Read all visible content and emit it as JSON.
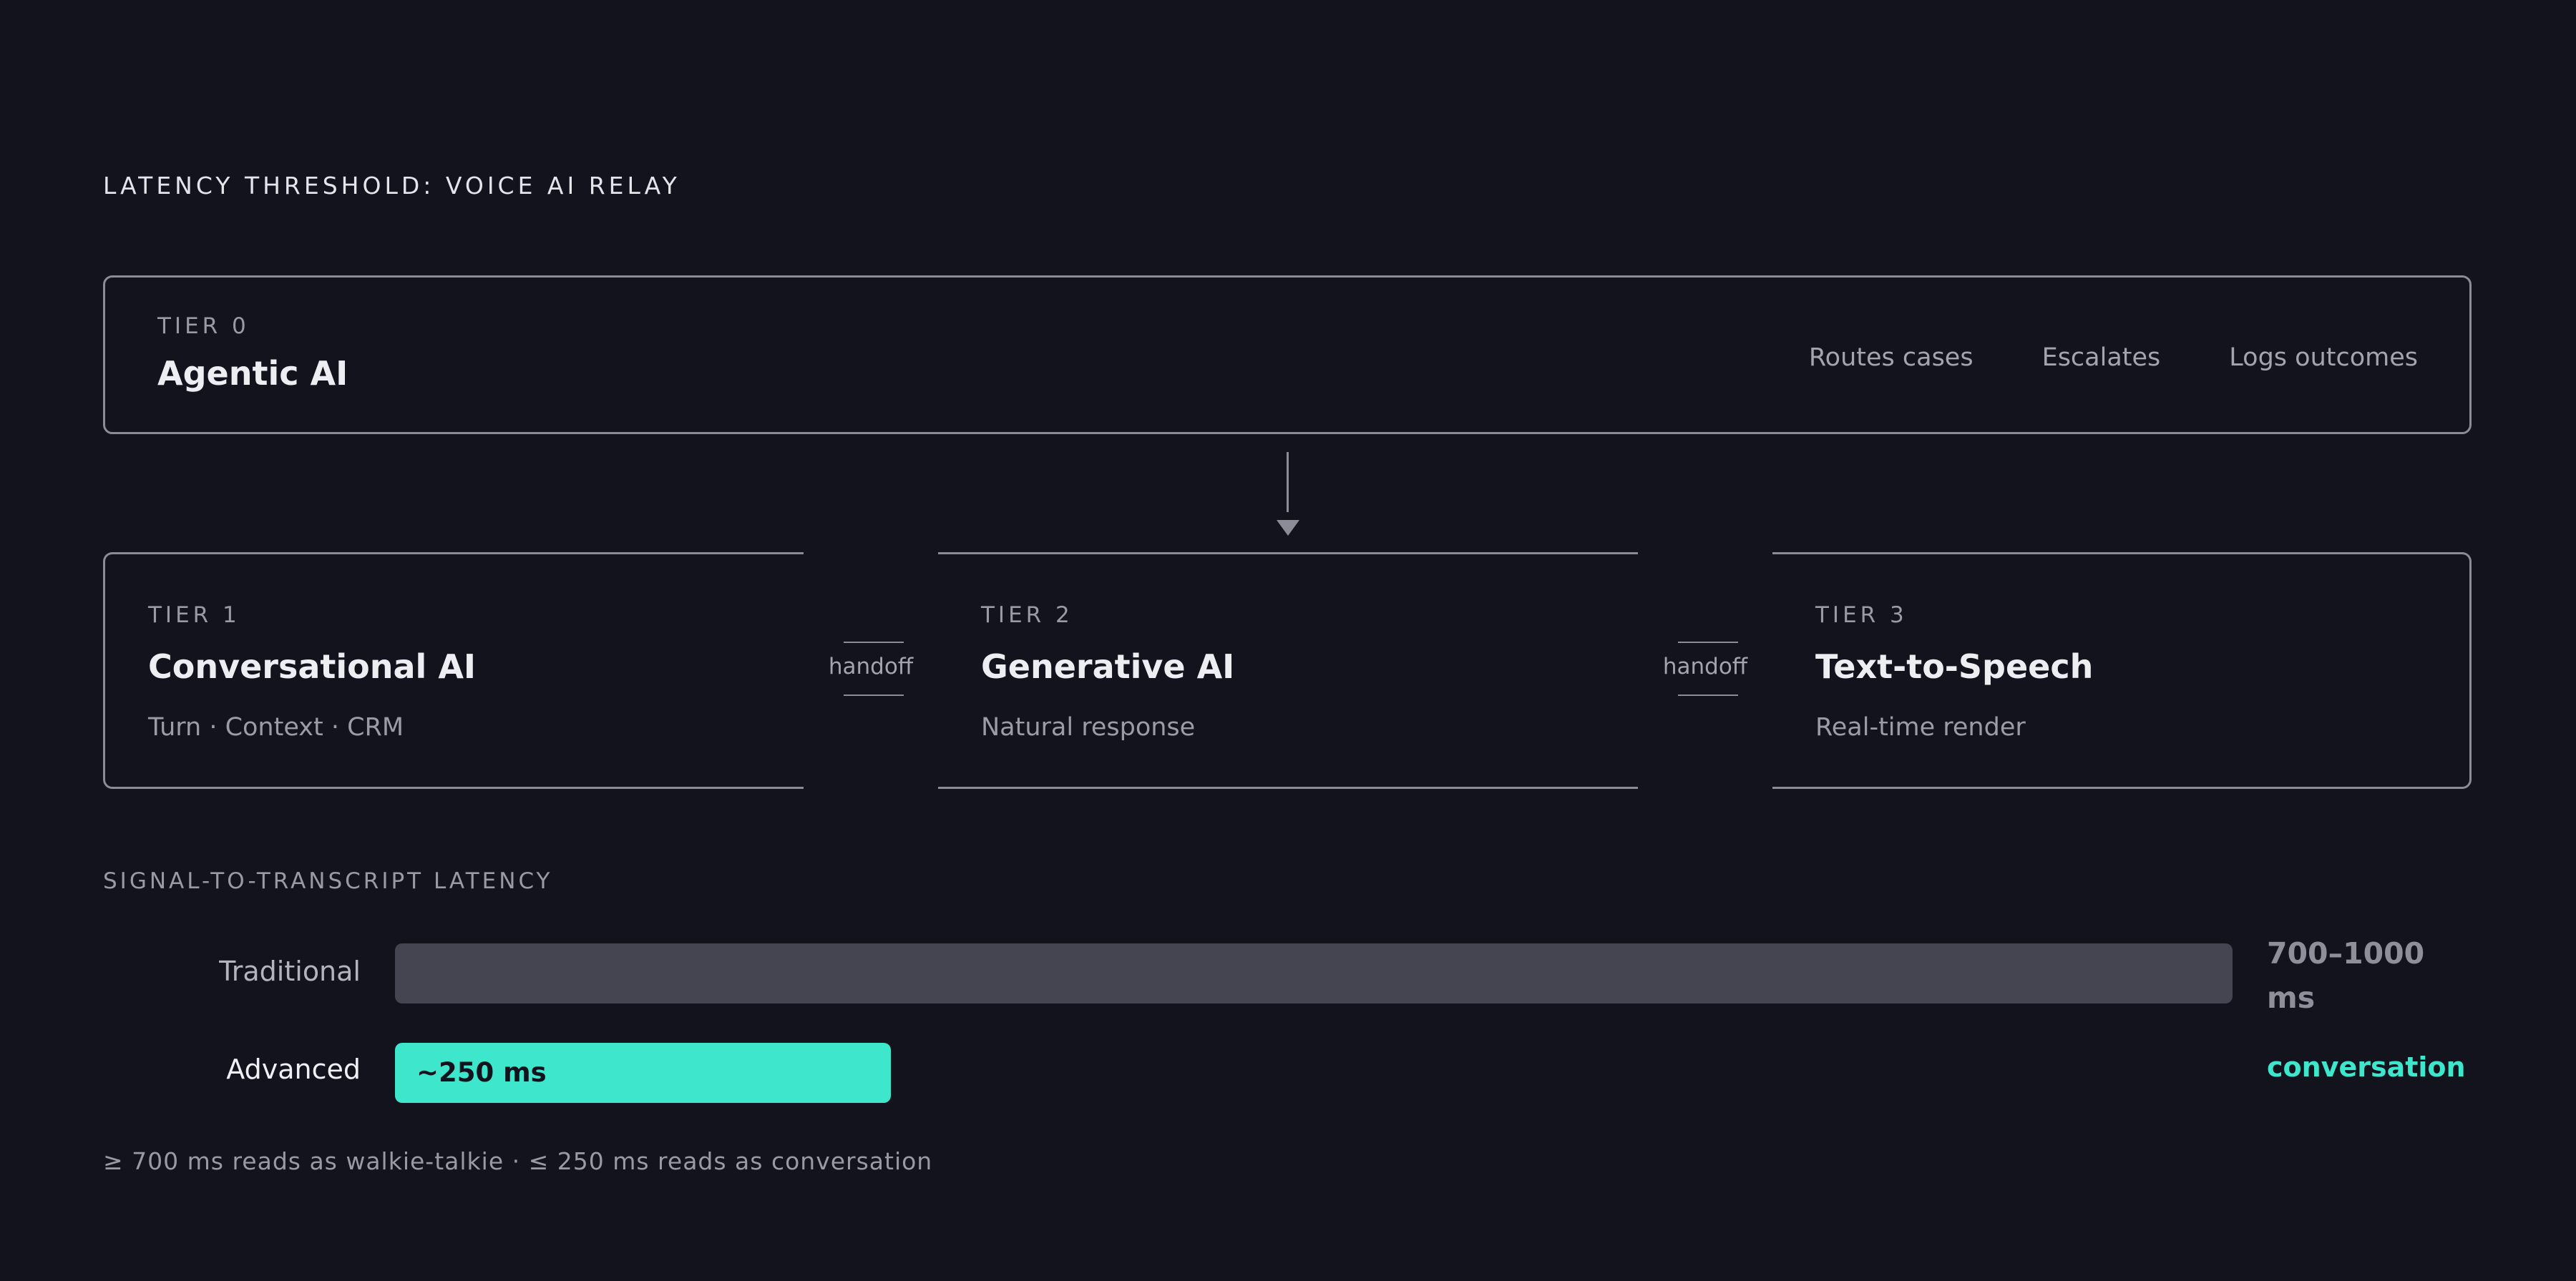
{
  "title": "LATENCY THRESHOLD: VOICE AI RELAY",
  "tier0": {
    "label": "TIER 0",
    "name": "Agentic AI",
    "actions": [
      "Routes cases",
      "Escalates",
      "Logs outcomes"
    ]
  },
  "tiers": [
    {
      "label": "TIER 1",
      "name": "Conversational AI",
      "desc": "Turn · Context · CRM"
    },
    {
      "label": "TIER 2",
      "name": "Generative AI",
      "desc": "Natural response"
    },
    {
      "label": "TIER 3",
      "name": "Text-to-Speech",
      "desc": "Real-time render"
    }
  ],
  "handoffs": [
    "handoff",
    "handoff"
  ],
  "latency": {
    "title": "SIGNAL-TO-TRANSCRIPT LATENCY",
    "bars": [
      {
        "label": "Traditional",
        "inner_label": "",
        "side_label": "700–1000 ms",
        "fraction": 1.0,
        "color": "#444551"
      },
      {
        "label": "Advanced",
        "inner_label": "~250 ms",
        "side_label": "conversation",
        "fraction": 0.27,
        "color": "#3ee6cb"
      }
    ]
  },
  "footnote": "≥ 700 ms reads as walkie-talkie · ≤ 250 ms reads as conversation",
  "colors": {
    "background": "#13131e",
    "accent": "#3ee6cb",
    "border": "#8c8c98"
  }
}
